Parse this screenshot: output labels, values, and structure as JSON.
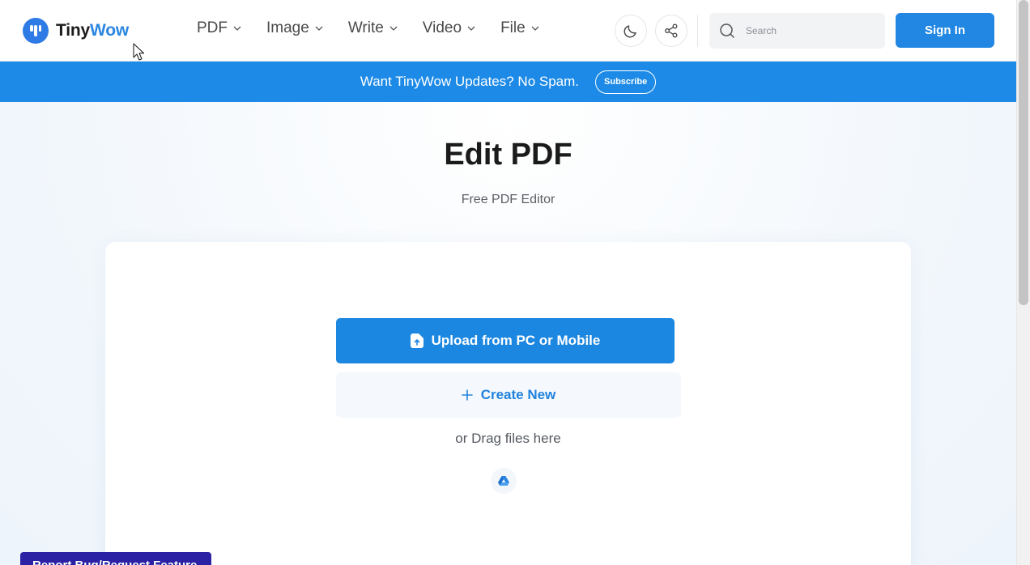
{
  "brand": {
    "name_part1": "Tiny",
    "name_part2": "Wow",
    "color": "#2a86e0"
  },
  "nav": {
    "items": [
      {
        "label": "PDF"
      },
      {
        "label": "Image"
      },
      {
        "label": "Write"
      },
      {
        "label": "Video"
      },
      {
        "label": "File"
      }
    ]
  },
  "header": {
    "theme_icon": "moon-icon",
    "share_icon": "share-icon",
    "search": {
      "placeholder": "Search",
      "value": ""
    },
    "signin_label": "Sign In"
  },
  "banner": {
    "text": "Want TinyWow Updates? No Spam.",
    "button_label": "Subscribe",
    "color": "#1c8ae6"
  },
  "main": {
    "title": "Edit PDF",
    "subtitle": "Free PDF Editor",
    "upload_label": "Upload from PC or Mobile",
    "create_label": "Create New",
    "drag_text": "or Drag files here",
    "drive_icon": "google-drive-icon"
  },
  "footer": {
    "report_label": "Report Bug/Request Feature",
    "report_color": "#2a21a5"
  },
  "colors": {
    "primary": "#1c87e1",
    "text_dark": "#1b1b1b"
  }
}
